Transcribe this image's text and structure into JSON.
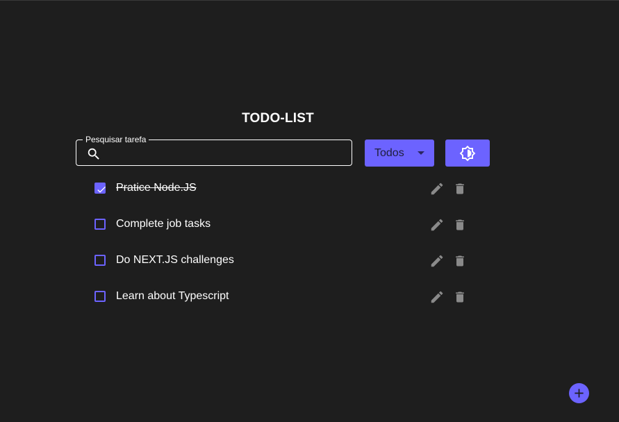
{
  "app": {
    "title": "TODO-LIST"
  },
  "search": {
    "label": "Pesquisar tarefa",
    "value": "",
    "placeholder": "",
    "icon": "search-icon"
  },
  "filter": {
    "selected": "Todos"
  },
  "theme_toggle": {
    "icon": "brightness-icon"
  },
  "tasks": [
    {
      "label": "Pratice Node.JS",
      "done": true
    },
    {
      "label": "Complete job tasks",
      "done": false
    },
    {
      "label": "Do NEXT.JS challenges",
      "done": false
    },
    {
      "label": "Learn about Typescript",
      "done": false
    }
  ],
  "colors": {
    "background": "#1e1e1e",
    "accent": "#6c63ff",
    "icon_gray": "#8a8a8a",
    "text": "#ffffff"
  },
  "fab": {
    "icon": "plus-icon"
  }
}
